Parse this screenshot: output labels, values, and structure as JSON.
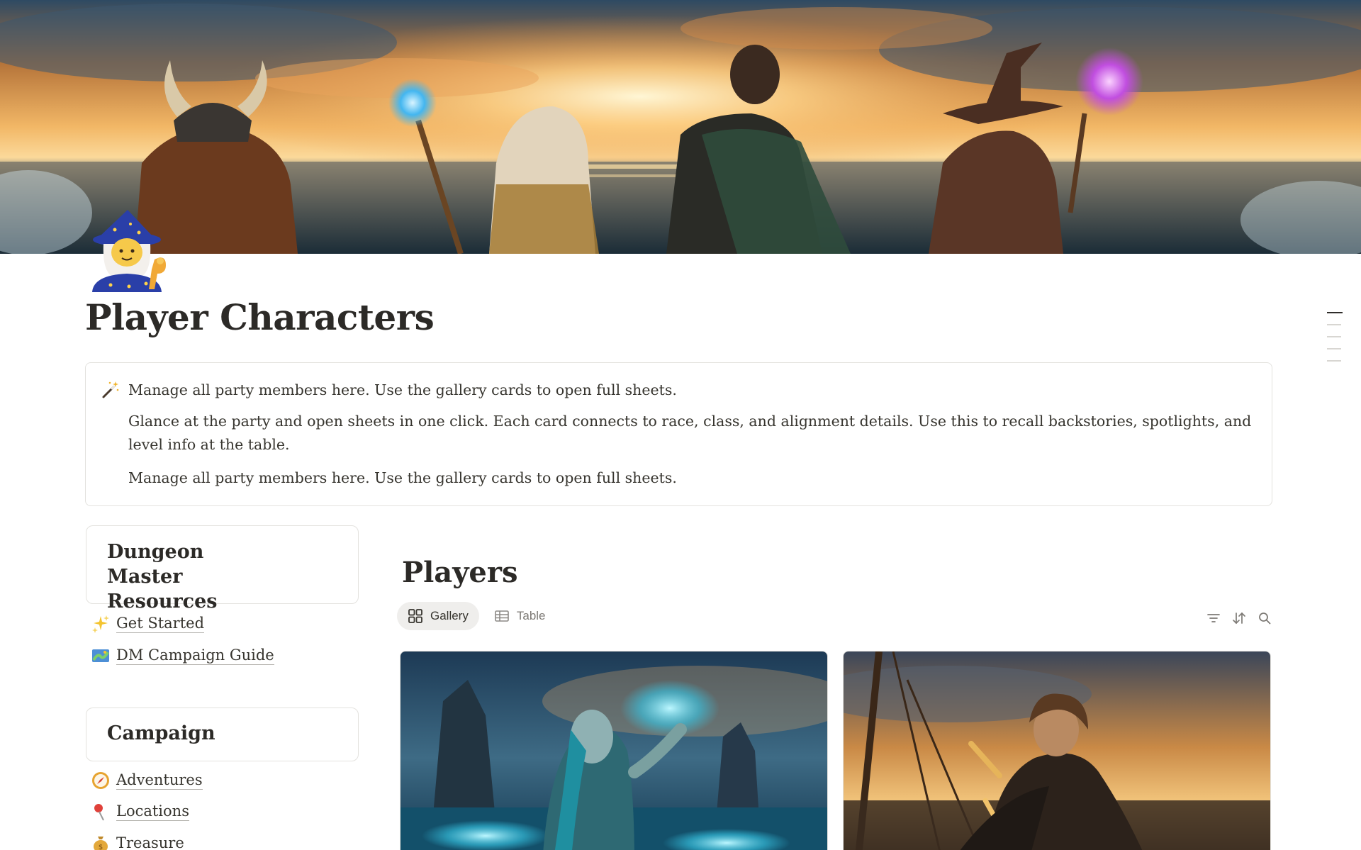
{
  "page": {
    "title": "Player Characters",
    "icon": "wizard-emoji-icon"
  },
  "callout": {
    "icon": "magic-wand-icon",
    "lines": [
      "Manage all party members here. Use the gallery cards to open full sheets.",
      "Glance at the party and open sheets in one click. Each card connects to race, class, and alignment details. Use this to recall backstories, spotlights, and level info at the table.",
      "Manage all party members here. Use the gallery cards to open full sheets."
    ]
  },
  "sidebar": {
    "dm_resources": {
      "heading": "Dungeon Master Resources",
      "links": [
        {
          "label": "Get Started",
          "icon": "sparkles-icon"
        },
        {
          "label": "DM Campaign Guide",
          "icon": "map-icon"
        }
      ]
    },
    "campaign": {
      "heading": "Campaign",
      "links": [
        {
          "label": "Adventures",
          "icon": "compass-icon"
        },
        {
          "label": "Locations",
          "icon": "pin-icon"
        },
        {
          "label": "Treasure",
          "icon": "money-bag-icon"
        }
      ]
    }
  },
  "database": {
    "title": "Players",
    "views": [
      {
        "label": "Gallery",
        "icon": "gallery-icon",
        "active": true
      },
      {
        "label": "Table",
        "icon": "table-icon",
        "active": false
      }
    ],
    "tools": [
      "filter-icon",
      "sort-icon",
      "search-icon"
    ],
    "cards": [
      {
        "image": "sea-elf-druid-illustration"
      },
      {
        "image": "halfling-rogue-illustration"
      }
    ]
  }
}
